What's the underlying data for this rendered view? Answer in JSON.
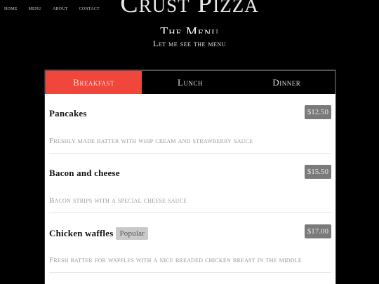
{
  "nav": {
    "links": [
      "home",
      "menu",
      "about",
      "contact"
    ]
  },
  "brand": {
    "title": "Crust Pizza"
  },
  "section": {
    "heading": "The Menu",
    "subtitle": "Let me see the menu"
  },
  "tabs": [
    {
      "label": "Breakfast",
      "active": true
    },
    {
      "label": "Lunch",
      "active": false
    },
    {
      "label": "Dinner",
      "active": false
    }
  ],
  "items": [
    {
      "name": "Pancakes",
      "badge": "",
      "price": "$12.50",
      "description": "Freshly made batter with whip cream and strawberry sauce"
    },
    {
      "name": "Bacon and cheese",
      "badge": "",
      "price": "$15.50",
      "description": "Bacon strips with a special cheese sauce"
    },
    {
      "name": "Chicken waffles",
      "badge": "Popular",
      "price": "$17.00",
      "description": "Fresh batter for waffles with a nice breaded chicken breast in the middle"
    }
  ],
  "colors": {
    "accent": "#f0463b",
    "background": "#000000",
    "price_badge": "#7a7a7a",
    "popular_badge": "#c9c9c9"
  }
}
